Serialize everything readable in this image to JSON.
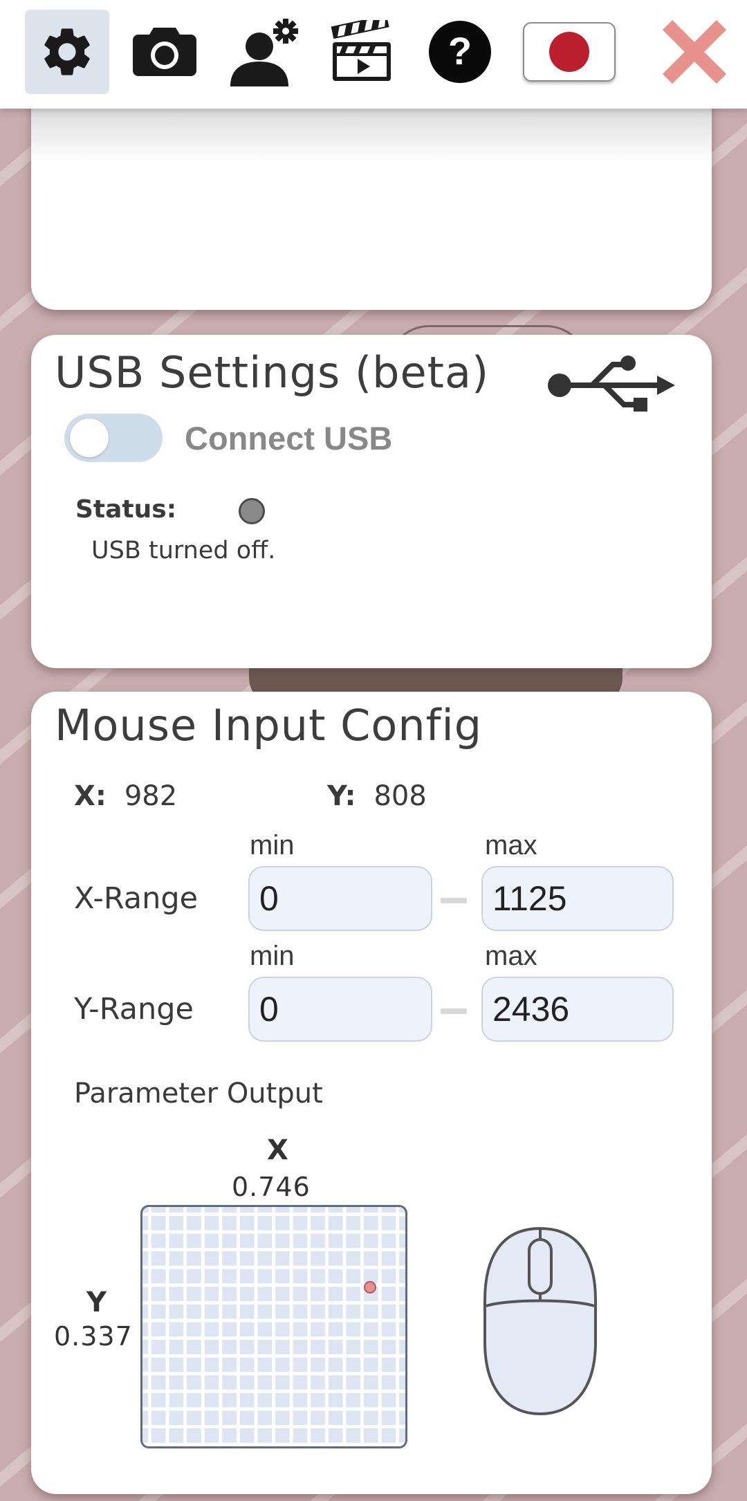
{
  "toolbar": {
    "items": [
      "settings-icon",
      "camera-icon",
      "user-settings-icon",
      "video-icon",
      "help-icon",
      "language-flag-japan",
      "close-icon"
    ],
    "active": "settings",
    "close_color": "#e8928e",
    "flag_color": "#bc1f2d"
  },
  "usb": {
    "title": "USB Settings (beta)",
    "toggle_label": "Connect USB",
    "toggle_on": false,
    "status_label": "Status:",
    "status_text": "USB turned off.",
    "status_color": "#8a8a8a"
  },
  "mouse": {
    "title": "Mouse Input Config",
    "x_label": "X:",
    "x_value": "982",
    "y_label": "Y:",
    "y_value": "808",
    "min_label": "min",
    "max_label": "max",
    "x_range_label": "X-Range",
    "x_min": "0",
    "x_max": "1125",
    "y_range_label": "Y-Range",
    "y_min": "0",
    "y_max": "2436",
    "param_title": "Parameter Output",
    "param_x_label": "X",
    "param_x_value": "0.746",
    "param_y_label": "Y",
    "param_y_value": "0.337",
    "point_x": 0.87,
    "point_y": 0.34
  }
}
